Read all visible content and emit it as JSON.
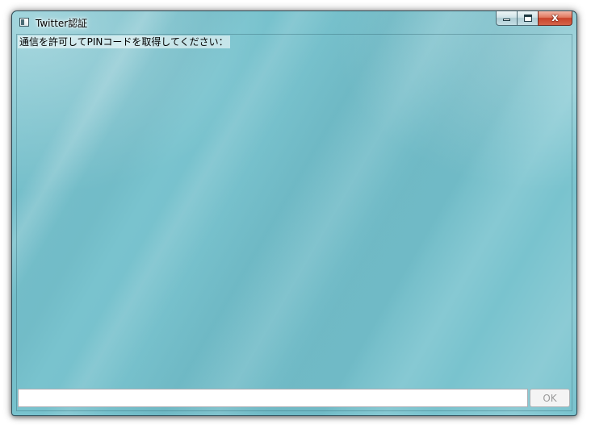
{
  "window": {
    "title": "Twitter認証",
    "app_icon": "window-app-icon",
    "controls": {
      "minimize_icon": "minimize-icon",
      "maximize_icon": "maximize-icon",
      "close_glyph": "x"
    }
  },
  "main": {
    "instruction": "通信を許可してPINコードを取得してください："
  },
  "footer": {
    "pin_input_value": "",
    "ok_label": "OK",
    "ok_enabled": false
  },
  "colors": {
    "window_background": "#79c3ce",
    "close_button": "#c8432a"
  }
}
